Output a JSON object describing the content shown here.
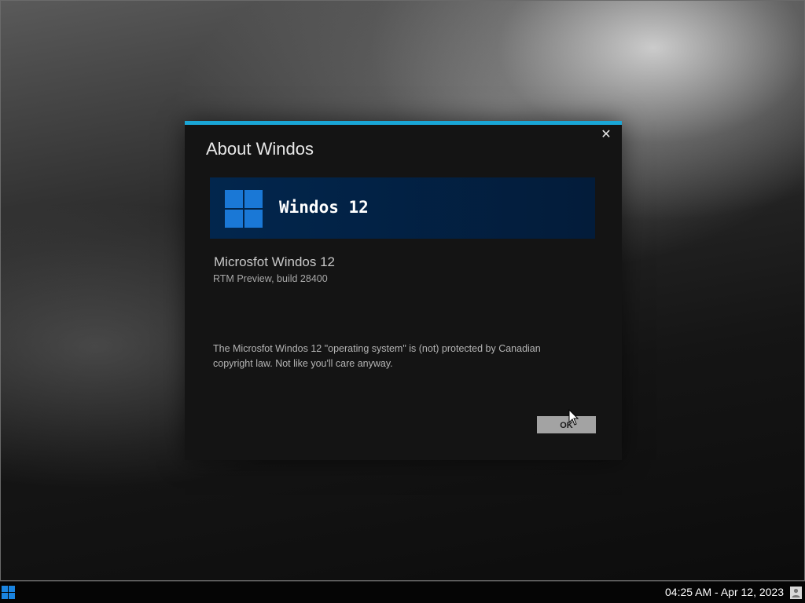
{
  "dialog": {
    "title": "About Windos",
    "close_label": "✕",
    "banner_product_name": "Windos 12",
    "product_full_name": "Microsfot Windos 12",
    "build_info": "RTM Preview, build 28400",
    "legal_text": "The Microsfot Windos 12 \"operating system\" is (not) protected by Canadian copyright law. Not like you'll care anyway.",
    "ok_label": "OK"
  },
  "taskbar": {
    "clock": "04:25 AM - Apr 12, 2023"
  },
  "icons": {
    "logo": "windows-logo-icon",
    "start": "start-icon",
    "close": "close-icon",
    "user": "user-icon",
    "cursor": "mouse-cursor-icon"
  },
  "colors": {
    "accent": "#1aa6d6",
    "banner": "#02264d",
    "logo_blue": "#1a78d6",
    "dialog_bg": "#141414",
    "ok_button": "#a3a3a3"
  }
}
